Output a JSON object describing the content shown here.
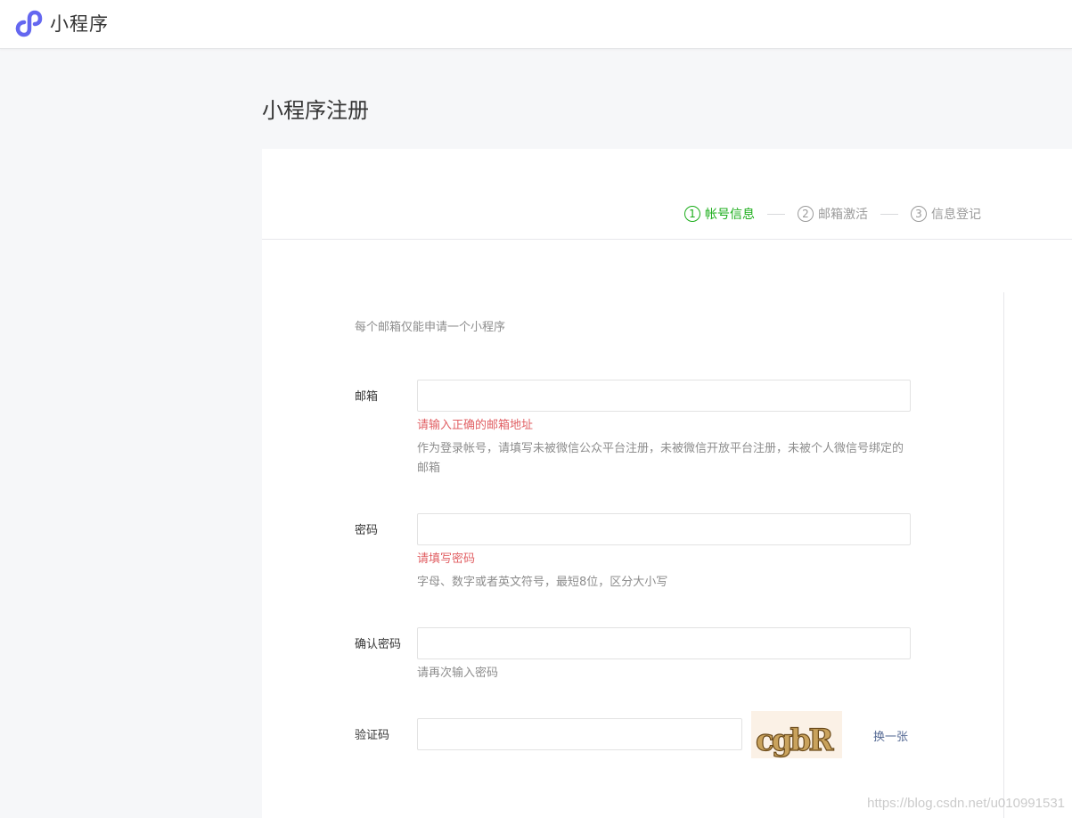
{
  "header": {
    "app_name": "小程序",
    "logo_icon": "mini-program-logo-icon",
    "accent_color": "#6467f0"
  },
  "page": {
    "title": "小程序注册"
  },
  "steps": [
    {
      "num": "1",
      "label": "帐号信息",
      "active": true
    },
    {
      "num": "2",
      "label": "邮箱激活",
      "active": false
    },
    {
      "num": "3",
      "label": "信息登记",
      "active": false
    }
  ],
  "form": {
    "tip": "每个邮箱仅能申请一个小程序",
    "email": {
      "label": "邮箱",
      "value": "",
      "placeholder": "",
      "error": "请输入正确的邮箱地址",
      "help": "作为登录帐号，请填写未被微信公众平台注册，未被微信开放平台注册，未被个人微信号绑定的邮箱"
    },
    "password": {
      "label": "密码",
      "value": "",
      "placeholder": "",
      "error": "请填写密码",
      "help": "字母、数字或者英文符号，最短8位，区分大小写"
    },
    "confirm_password": {
      "label": "确认密码",
      "value": "",
      "placeholder": "",
      "help": "请再次输入密码"
    },
    "captcha": {
      "label": "验证码",
      "value": "",
      "placeholder": "",
      "image_text": "cgbR",
      "refresh_label": "换一张"
    }
  },
  "colors": {
    "active_step": "#1aad19",
    "error": "#e15f63",
    "link": "#576b95"
  },
  "watermark": "https://blog.csdn.net/u010991531"
}
